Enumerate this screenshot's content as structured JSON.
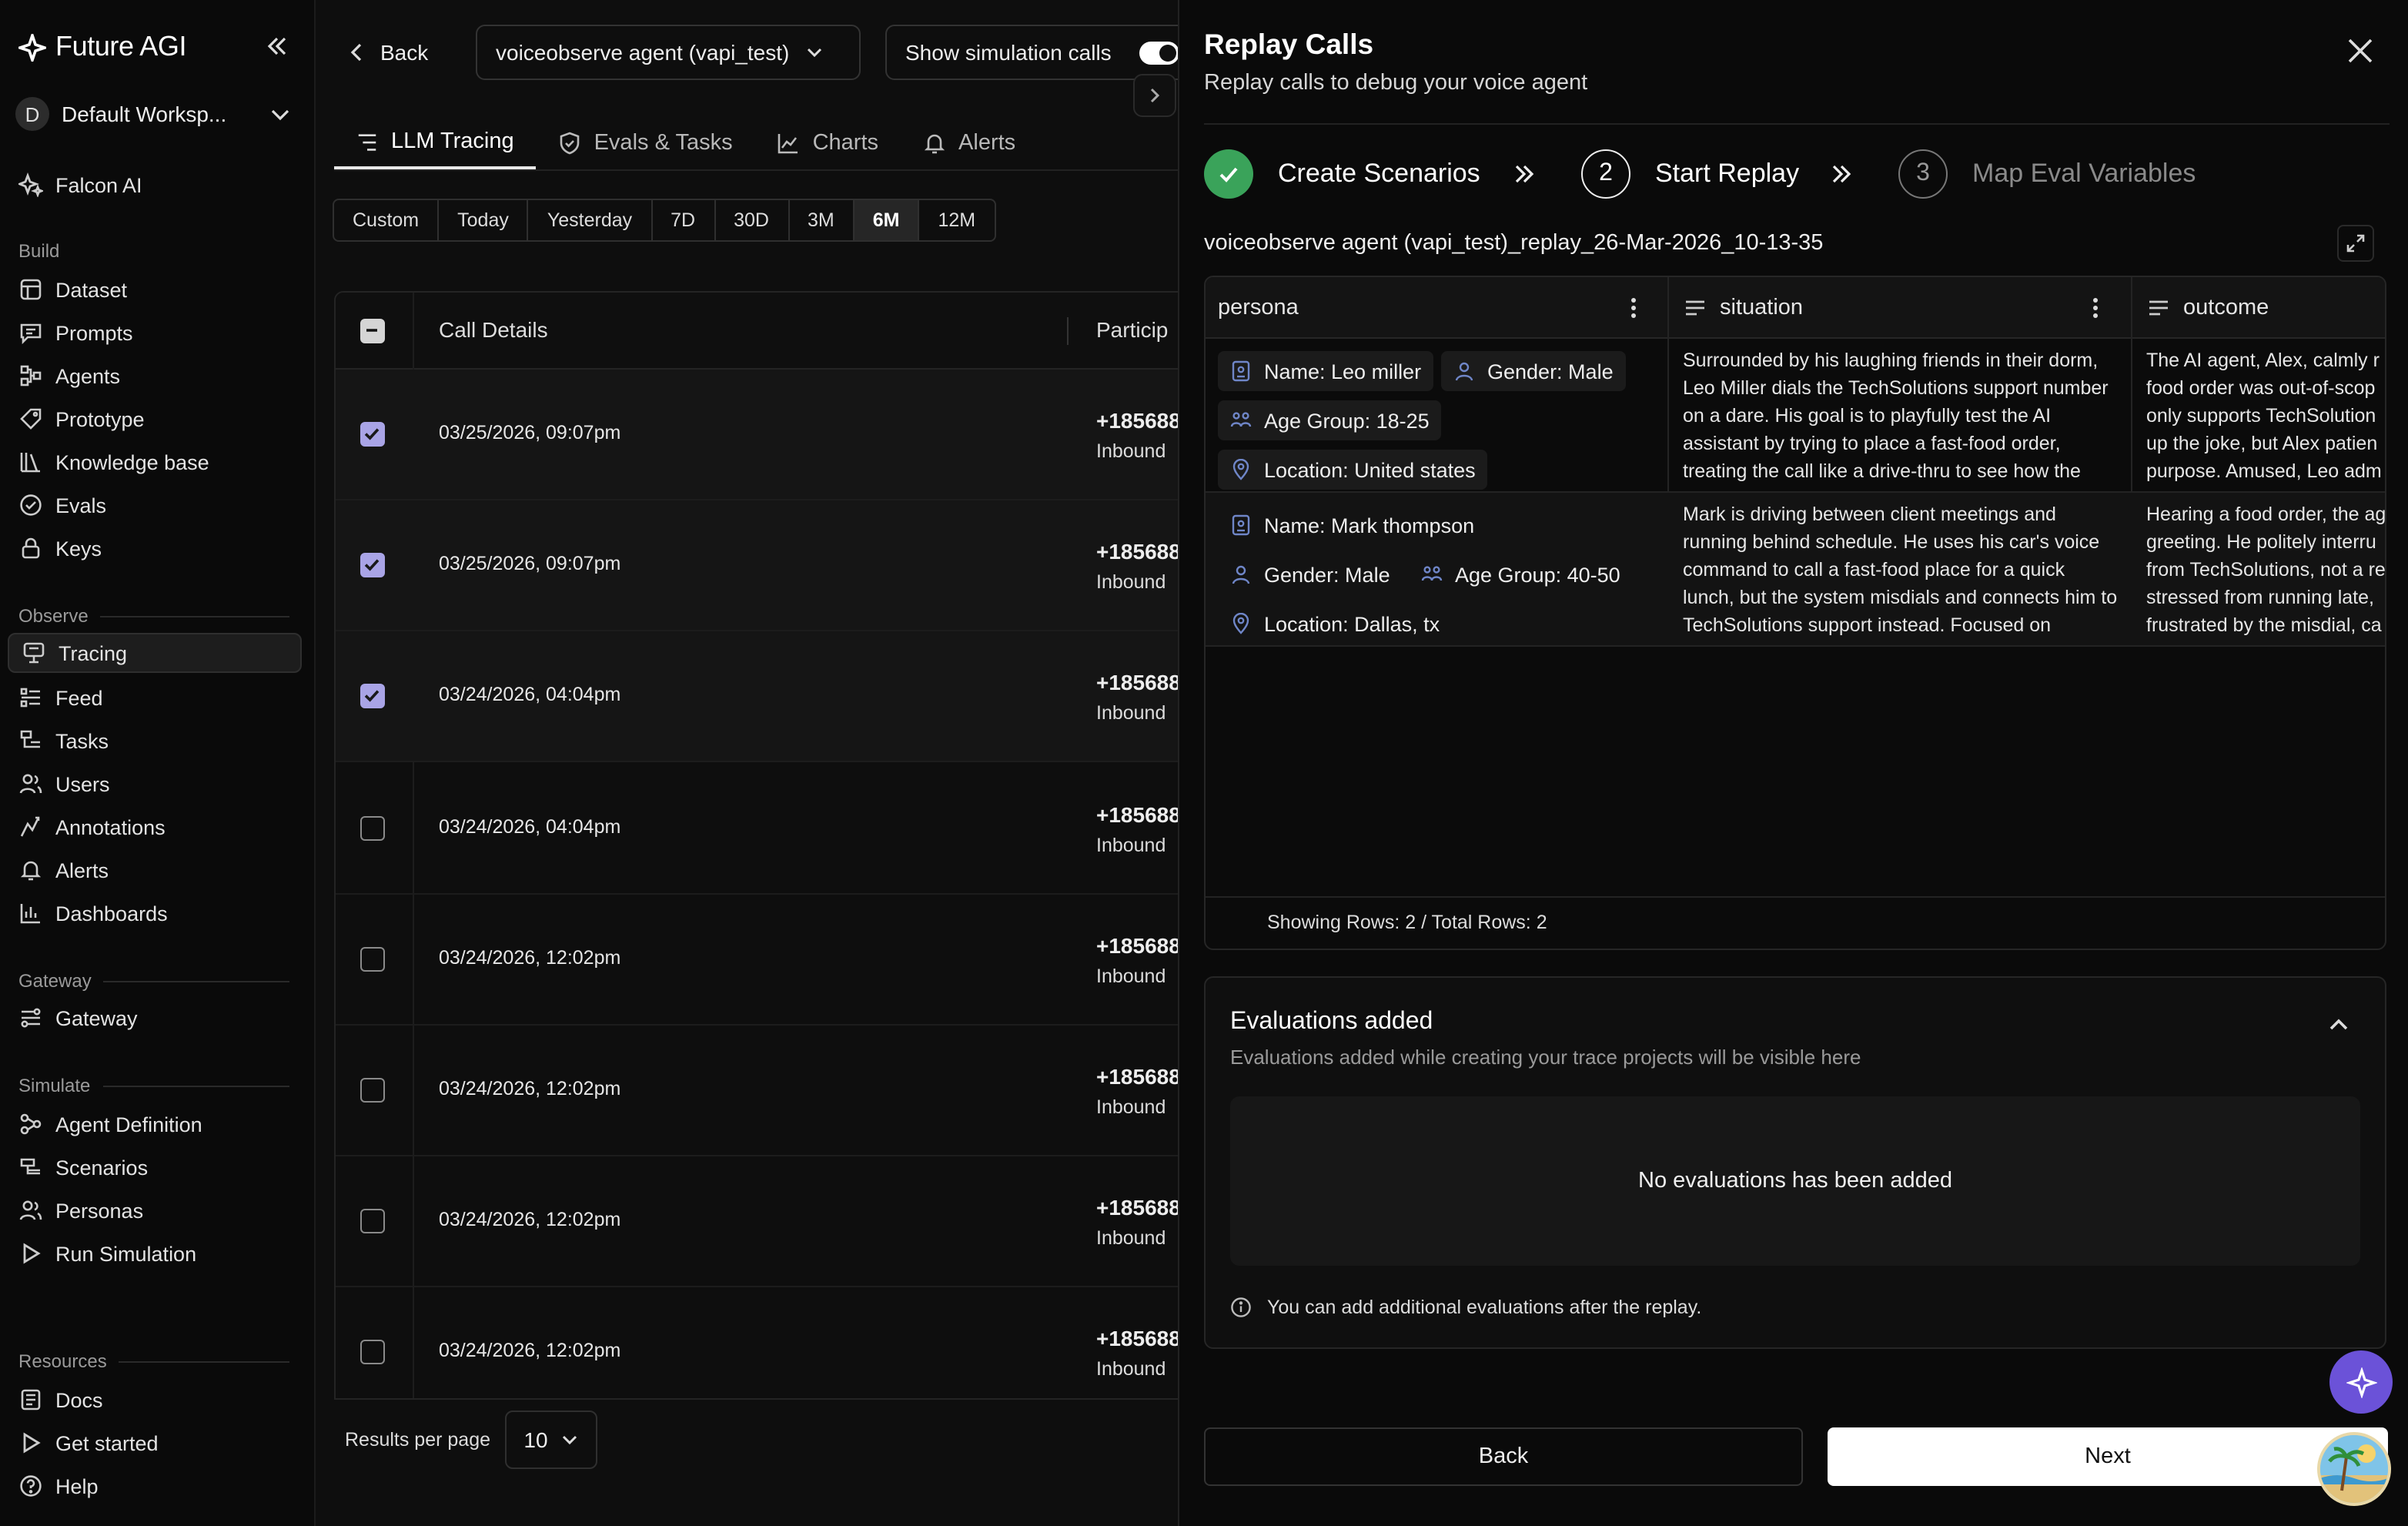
{
  "sidebar": {
    "brand": "Future AGI",
    "workspace": {
      "initial": "D",
      "name": "Default Worksp..."
    },
    "falcon": "Falcon AI",
    "sections": {
      "build": "Build",
      "observe": "Observe",
      "gateway": "Gateway",
      "simulate": "Simulate",
      "resources": "Resources"
    },
    "build_items": [
      "Dataset",
      "Prompts",
      "Agents",
      "Prototype",
      "Knowledge base",
      "Evals",
      "Keys"
    ],
    "observe_items": [
      "Tracing",
      "Feed",
      "Tasks",
      "Users",
      "Annotations",
      "Alerts",
      "Dashboards"
    ],
    "gateway_items": [
      "Gateway"
    ],
    "simulate_items": [
      "Agent Definition",
      "Scenarios",
      "Personas",
      "Run Simulation"
    ],
    "resources_items": [
      "Docs",
      "Get started",
      "Help"
    ],
    "active_item": "Tracing"
  },
  "topbar": {
    "back": "Back",
    "agent_select": "voiceobserve agent (vapi_test)",
    "sim_toggle": "Show simulation calls",
    "sim_toggle_on": true
  },
  "tabs": [
    "LLM Tracing",
    "Evals & Tasks",
    "Charts",
    "Alerts"
  ],
  "active_tab": "LLM Tracing",
  "ranges": [
    "Custom",
    "Today",
    "Yesterday",
    "7D",
    "30D",
    "3M",
    "6M",
    "12M"
  ],
  "active_range": "6M",
  "calls_table": {
    "headers": {
      "details": "Call Details",
      "participant": "Particip"
    },
    "rows": [
      {
        "date": "03/25/2026, 09:07pm",
        "phone": "+185688",
        "direction": "Inbound",
        "checked": true
      },
      {
        "date": "03/25/2026, 09:07pm",
        "phone": "+185688",
        "direction": "Inbound",
        "checked": true
      },
      {
        "date": "03/24/2026, 04:04pm",
        "phone": "+185688",
        "direction": "Inbound",
        "checked": true
      },
      {
        "date": "03/24/2026, 04:04pm",
        "phone": "+185688",
        "direction": "Inbound",
        "checked": false
      },
      {
        "date": "03/24/2026, 12:02pm",
        "phone": "+185688",
        "direction": "Inbound",
        "checked": false
      },
      {
        "date": "03/24/2026, 12:02pm",
        "phone": "+185688",
        "direction": "Inbound",
        "checked": false
      },
      {
        "date": "03/24/2026, 12:02pm",
        "phone": "+185688",
        "direction": "Inbound",
        "checked": false
      },
      {
        "date": "03/24/2026, 12:02pm",
        "phone": "+185688",
        "direction": "Inbound",
        "checked": false
      }
    ],
    "results_per_page_label": "Results per page",
    "results_per_page": "10"
  },
  "drawer": {
    "title": "Replay Calls",
    "subtitle": "Replay calls to debug your voice agent",
    "steps": [
      {
        "num": "✓",
        "label": "Create Scenarios",
        "state": "done"
      },
      {
        "num": "2",
        "label": "Start Replay",
        "state": "current"
      },
      {
        "num": "3",
        "label": "Map Eval Variables",
        "state": "pending"
      }
    ],
    "replay_name": "voiceobserve agent (vapi_test)_replay_26-Mar-2026_10-13-35",
    "grid": {
      "columns": [
        "persona",
        "situation",
        "outcome"
      ],
      "rows": [
        {
          "name": "Name: Leo miller",
          "gender": "Gender: Male",
          "age": "Age Group: 18-25",
          "location": "Location: United states",
          "situation": "Surrounded by his laughing friends in their dorm, Leo Miller dials the TechSolutions support number on a dare. His goal is to playfully test the AI assistant by trying to place a fast-food order, treating the call like a drive-thru to see how the",
          "outcome": "The AI agent, Alex, calmly r food order was out-of-scop only supports TechSolution up the joke, but Alex patien purpose. Amused, Leo adm"
        },
        {
          "name": "Name: Mark thompson",
          "gender": "Gender: Male",
          "age": "Age Group: 40-50",
          "location": "Location: Dallas, tx",
          "situation": "Mark is driving between client meetings and running behind schedule. He uses his car's voice command to call a fast-food place for a quick lunch, but the system misdials and connects him to TechSolutions support instead. Focused on",
          "outcome": "Hearing a food order, the ag greeting. He politely interru from TechSolutions, not a re stressed from running late, frustrated by the misdial, ca"
        }
      ],
      "showing": "Showing Rows: 2 / Total Rows: 2"
    },
    "evaluations": {
      "title": "Evaluations added",
      "subtitle": "Evaluations added while creating your trace projects will be visible here",
      "empty": "No evaluations has been added",
      "note": "You can add additional evaluations after the replay."
    },
    "back_button": "Back",
    "next_button": "Next"
  },
  "colors": {
    "accent": "#a9a4e6",
    "step_done": "#3aa35a",
    "fab": "#6b52d8"
  }
}
